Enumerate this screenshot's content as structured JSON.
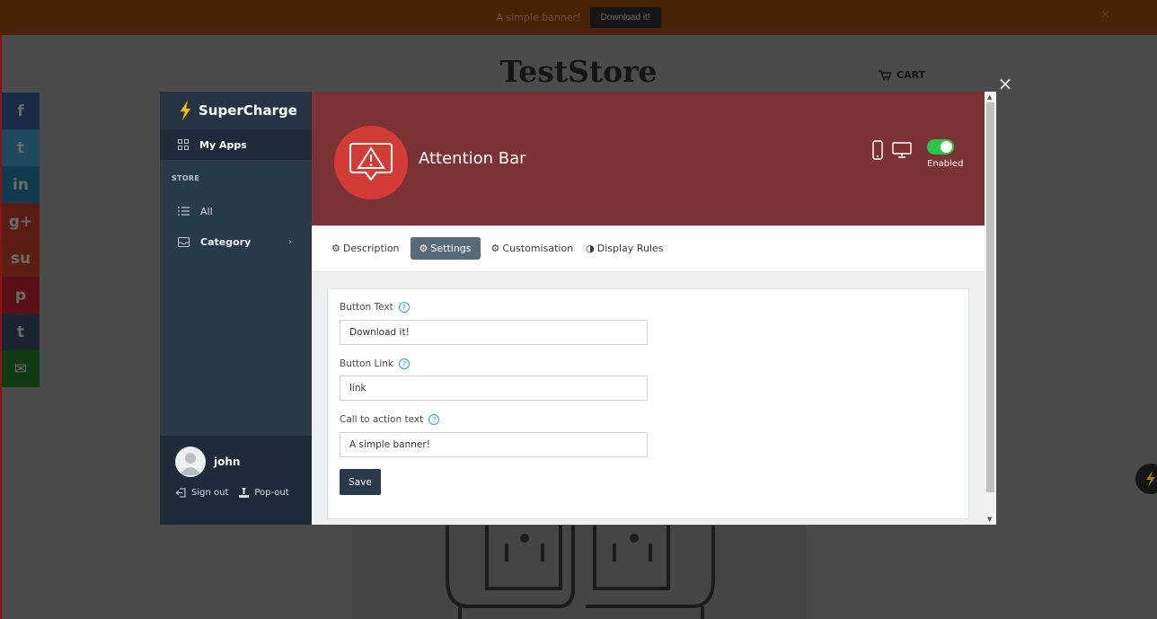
{
  "banner": {
    "text": "A simple banner!",
    "button_label": "Download it!",
    "close": "×"
  },
  "store": {
    "title": "TestStore",
    "cart_label": "CART"
  },
  "social_icons": [
    "facebook-icon",
    "twitter-icon",
    "linkedin-icon",
    "google-plus-icon",
    "stumbleupon-icon",
    "pinterest-icon",
    "tumblr-icon",
    "email-icon"
  ],
  "social_glyphs": [
    "f",
    "t",
    "in",
    "g+",
    "su",
    "p",
    "t",
    "✉"
  ],
  "social_colors": [
    "#1b2a45",
    "#1e4a5e",
    "#0f3a4f",
    "#5a1c14",
    "#5a1f10",
    "#5a1016",
    "#1a2430",
    "#0f3a12"
  ],
  "modal": {
    "close": "×"
  },
  "sidebar": {
    "brand": "SuperCharge",
    "nav_active": "My Apps",
    "section": "STORE",
    "items": [
      {
        "label": "All"
      },
      {
        "label": "Category"
      }
    ],
    "user": {
      "name": "john",
      "sign_out": "Sign out",
      "pop_out": "Pop-out"
    }
  },
  "app": {
    "title": "Attention Bar",
    "status": "Enabled",
    "enabled": true
  },
  "tabs": [
    {
      "label": "Description"
    },
    {
      "label": "Settings"
    },
    {
      "label": "Customisation"
    },
    {
      "label": "Display Rules"
    }
  ],
  "form": {
    "fields": [
      {
        "label": "Button Text",
        "value": "Download it!"
      },
      {
        "label": "Button Link",
        "value": "link"
      },
      {
        "label": "Call to action text",
        "value": "A simple banner!"
      }
    ],
    "save_label": "Save"
  },
  "colors": {
    "hero": "#7c3335",
    "sidebar": "#2b3a48",
    "toggle_on": "#2ec449",
    "logo": "#d23c36"
  }
}
